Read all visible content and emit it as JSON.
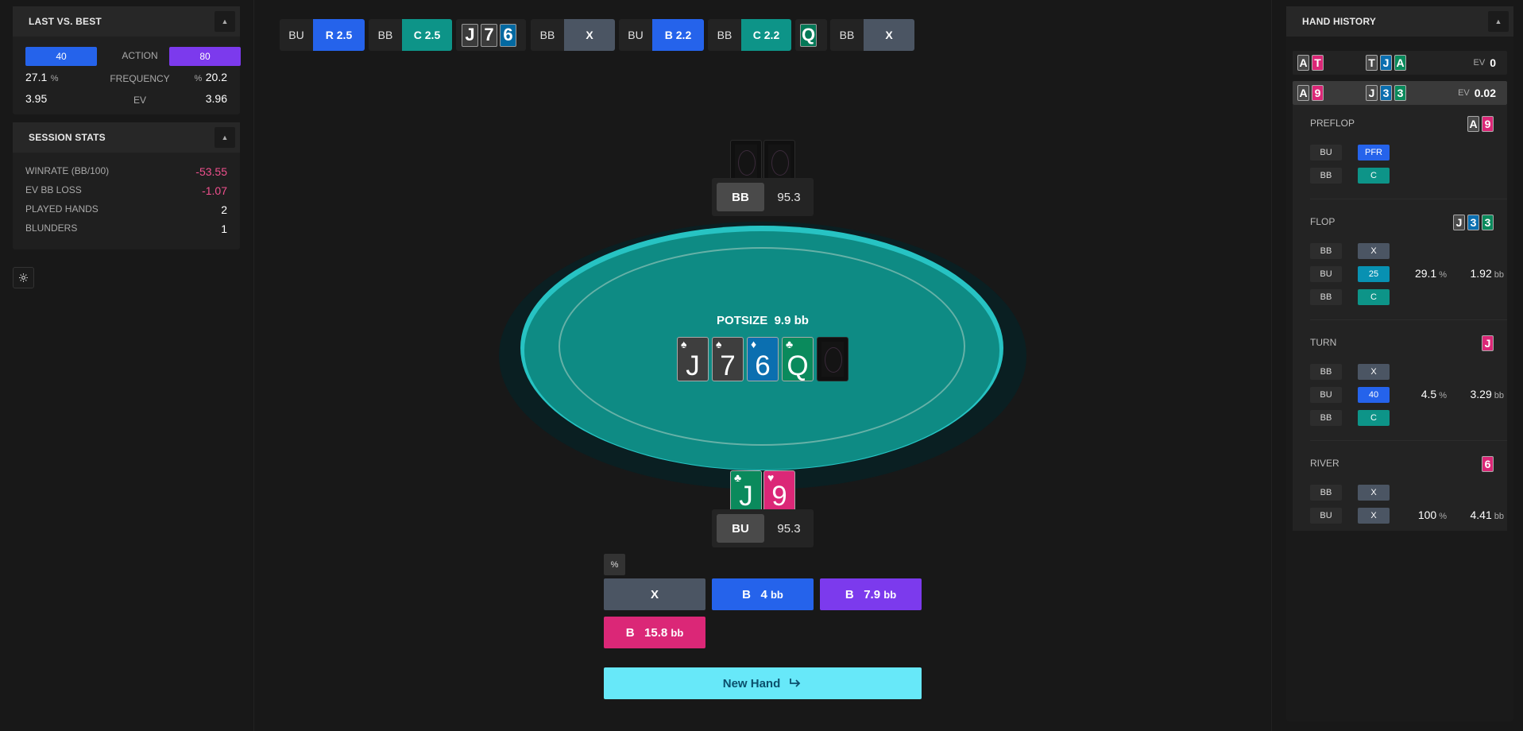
{
  "colors": {
    "blue": "#2563eb",
    "teal": "#0d9488",
    "purple": "#7c3aed",
    "pink": "#db2777",
    "slate": "#4b5563",
    "cyan": "#67e8f9",
    "felt": "#0e8b84"
  },
  "last_vs_best": {
    "title": "LAST VS. BEST",
    "last_action": "40",
    "action_label": "ACTION",
    "best_action": "80",
    "last_freq": "27.1",
    "freq_unit": "%",
    "freq_label": "FREQUENCY",
    "best_freq_unit": "%",
    "best_freq": "20.2",
    "last_ev": "3.95",
    "ev_label": "EV",
    "best_ev": "3.96"
  },
  "session_stats": {
    "title": "SESSION STATS",
    "rows": [
      {
        "label": "WINRATE (BB/100)",
        "value": "-53.55"
      },
      {
        "label": "EV BB LOSS",
        "value": "-1.07"
      },
      {
        "label": "PLAYED HANDS",
        "value": "2"
      },
      {
        "label": "BLUNDERS",
        "value": "1"
      }
    ]
  },
  "settings_icon": "gear-icon",
  "action_bar": {
    "items": [
      {
        "pos": "BU",
        "act": "R 2.5"
      },
      {
        "pos": "BB",
        "act": "C 2.5"
      },
      {
        "board": [
          "J",
          "7",
          "6"
        ]
      },
      {
        "pos": "BB",
        "act": "X"
      },
      {
        "pos": "BU",
        "act": "B 2.2"
      },
      {
        "pos": "BB",
        "act": "C 2.2"
      },
      {
        "board": [
          "Q"
        ]
      },
      {
        "pos": "BB",
        "act": "X"
      }
    ]
  },
  "table": {
    "potsize_label": "POTSIZE",
    "potsize_value": "9.9 bb",
    "board": [
      {
        "rank": "J",
        "suit": "♠"
      },
      {
        "rank": "7",
        "suit": "♠"
      },
      {
        "rank": "6",
        "suit": "♦"
      },
      {
        "rank": "Q",
        "suit": "♣"
      }
    ],
    "villain": {
      "name": "BB",
      "stack": "95.3"
    },
    "hero": {
      "name": "BU",
      "stack": "95.3",
      "cards": [
        {
          "rank": "J",
          "suit": "♣"
        },
        {
          "rank": "9",
          "suit": "♥"
        }
      ]
    }
  },
  "actions": {
    "toggle_icon": "%",
    "check": "X",
    "bet1": {
      "prefix": "B",
      "amount": "4",
      "unit": "bb"
    },
    "bet2": {
      "prefix": "B",
      "amount": "7.9",
      "unit": "bb"
    },
    "bet3": {
      "prefix": "B",
      "amount": "15.8",
      "unit": "bb"
    },
    "new_hand": "New Hand"
  },
  "hand_history": {
    "title": "HAND HISTORY",
    "hands": [
      {
        "hole": [
          "A",
          "T"
        ],
        "board": [
          "T",
          "J",
          "A"
        ],
        "ev_label": "EV",
        "ev": "0"
      },
      {
        "hole": [
          "A",
          "9"
        ],
        "board": [
          "J",
          "3",
          "3"
        ],
        "ev_label": "EV",
        "ev": "0.02"
      }
    ],
    "streets": {
      "preflop": {
        "title": "PREFLOP",
        "cards": [
          "A",
          "9"
        ],
        "rows": [
          {
            "pos": "BU",
            "act": "PFR"
          },
          {
            "pos": "BB",
            "act": "C"
          }
        ]
      },
      "flop": {
        "title": "FLOP",
        "cards": [
          "J",
          "3",
          "3"
        ],
        "rows": [
          {
            "pos": "BB",
            "act": "X"
          },
          {
            "pos": "BU",
            "act": "25",
            "freq": "29.1",
            "unit": "%",
            "bb": "1.92",
            "bb_unit": "bb"
          },
          {
            "pos": "BB",
            "act": "C"
          }
        ]
      },
      "turn": {
        "title": "TURN",
        "cards": [
          "J"
        ],
        "rows": [
          {
            "pos": "BB",
            "act": "X"
          },
          {
            "pos": "BU",
            "act": "40",
            "freq": "4.5",
            "unit": "%",
            "bb": "3.29",
            "bb_unit": "bb"
          },
          {
            "pos": "BB",
            "act": "C"
          }
        ]
      },
      "river": {
        "title": "RIVER",
        "cards": [
          "6"
        ],
        "rows": [
          {
            "pos": "BB",
            "act": "X"
          },
          {
            "pos": "BU",
            "act": "X",
            "freq": "100",
            "unit": "%",
            "bb": "4.41",
            "bb_unit": "bb"
          }
        ]
      }
    }
  }
}
